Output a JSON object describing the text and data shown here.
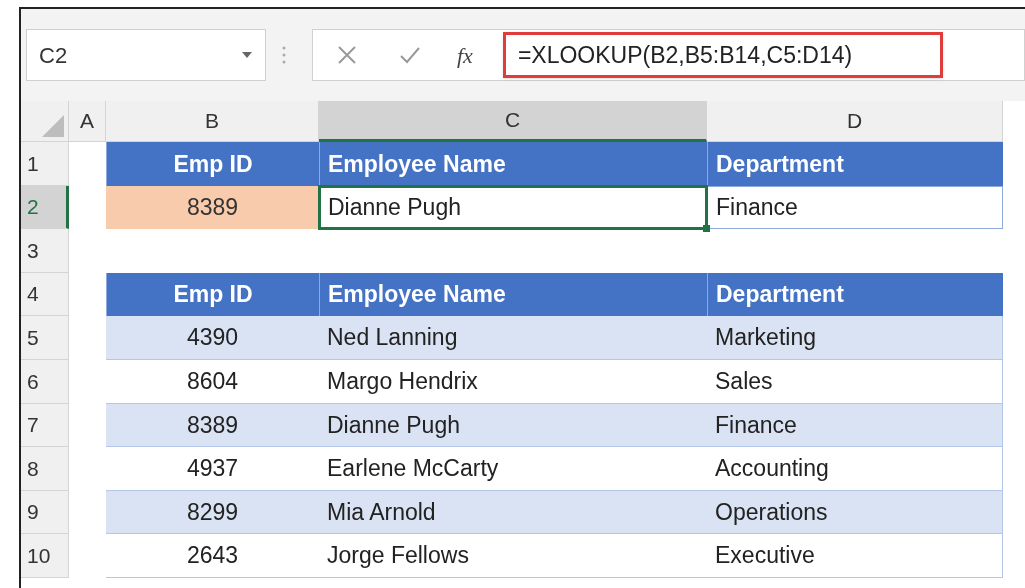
{
  "name_box": "C2",
  "formula_bar": {
    "function_label": "fx",
    "formula": "=XLOOKUP(B2,B5:B14,C5:D14)",
    "highlighted": true
  },
  "column_headers": [
    {
      "label": "A",
      "selected": false
    },
    {
      "label": "B",
      "selected": false
    },
    {
      "label": "C",
      "selected": true
    },
    {
      "label": "D",
      "selected": false
    }
  ],
  "rows": [
    {
      "number": "1",
      "selected": false,
      "kind": "header",
      "cells": [
        "Emp ID",
        "Employee Name",
        "Department"
      ]
    },
    {
      "number": "2",
      "selected": true,
      "kind": "input",
      "cells": [
        "8389",
        "Dianne Pugh",
        "Finance"
      ]
    },
    {
      "number": "3",
      "selected": false,
      "kind": "empty",
      "cells": []
    },
    {
      "number": "4",
      "selected": false,
      "kind": "header",
      "cells": [
        "Emp ID",
        "Employee Name",
        "Department"
      ]
    },
    {
      "number": "5",
      "selected": false,
      "kind": "data",
      "shaded": true,
      "cells": [
        "4390",
        "Ned Lanning",
        "Marketing"
      ]
    },
    {
      "number": "6",
      "selected": false,
      "kind": "data",
      "shaded": false,
      "cells": [
        "8604",
        "Margo Hendrix",
        "Sales"
      ]
    },
    {
      "number": "7",
      "selected": false,
      "kind": "data",
      "shaded": true,
      "cells": [
        "8389",
        "Dianne Pugh",
        "Finance"
      ]
    },
    {
      "number": "8",
      "selected": false,
      "kind": "data",
      "shaded": false,
      "cells": [
        "4937",
        "Earlene McCarty",
        "Accounting"
      ]
    },
    {
      "number": "9",
      "selected": false,
      "kind": "data",
      "shaded": true,
      "cells": [
        "8299",
        "Mia Arnold",
        "Operations"
      ]
    },
    {
      "number": "10",
      "selected": false,
      "kind": "data",
      "shaded": false,
      "cells": [
        "2643",
        "Jorge Fellows",
        "Executive"
      ]
    }
  ]
}
